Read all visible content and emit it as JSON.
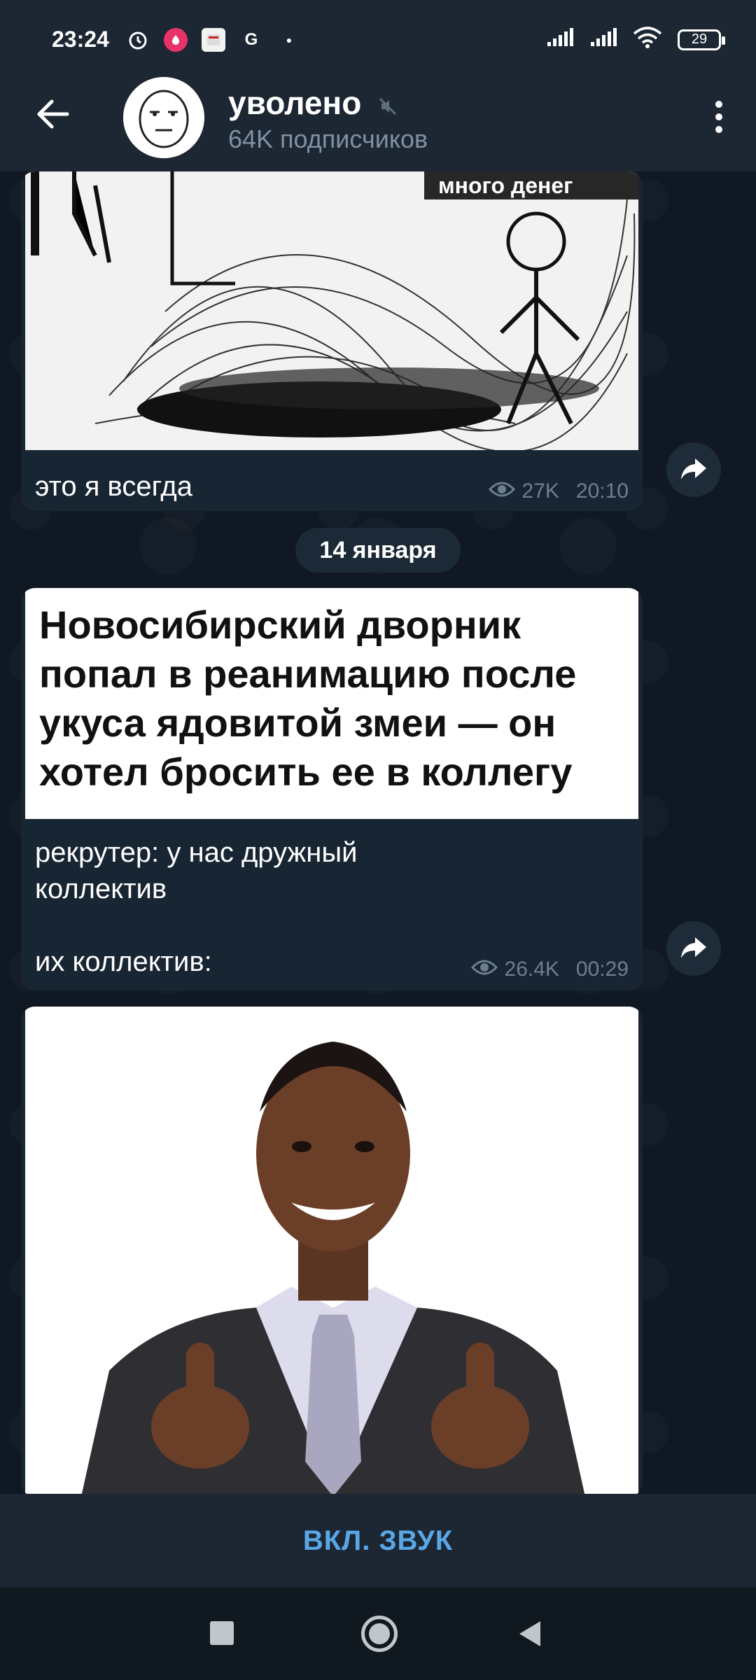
{
  "status_bar": {
    "time": "23:24",
    "battery": "29"
  },
  "header": {
    "title": "уволено",
    "subtitle": "64K подписчиков"
  },
  "messages": [
    {
      "image_text": "много денег",
      "caption": "это я всегда",
      "views": "27K",
      "time": "20:10"
    },
    {
      "headline": "Новосибирский дворник попал в реанимацию после укуса ядовитой змеи — он хотел бросить ее в коллегу",
      "caption_line1": "рекрутер: у нас дружный",
      "caption_line2": "коллектив",
      "caption_line3": "их коллектив:",
      "views": "26.4K",
      "time": "00:29"
    }
  ],
  "date_separator": "14 января",
  "bottom": {
    "unmute_label": "ВКЛ. ЗВУК"
  },
  "colors": {
    "accent": "#5aa7e6",
    "background": "#0e1621",
    "bubble": "#182533",
    "header": "#1c2733"
  }
}
